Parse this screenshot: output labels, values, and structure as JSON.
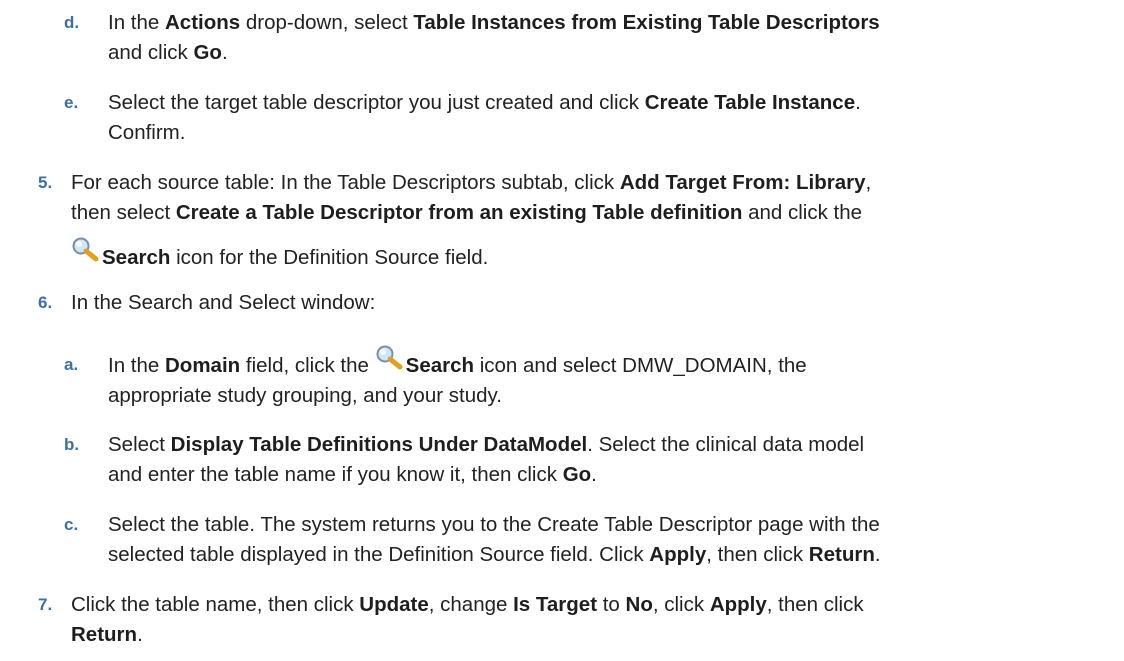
{
  "steps": {
    "d": {
      "marker": "d.",
      "t1": "In the ",
      "b1": "Actions",
      "t2": " drop-down, select ",
      "b2": "Table Instances from Existing Table Descriptors",
      "t3": "and click ",
      "b3": "Go",
      "t4": "."
    },
    "e": {
      "marker": "e.",
      "t1": "Select the target table descriptor you just created and click ",
      "b1": "Create Table Instance",
      "t2": ".",
      "t3": "Confirm."
    },
    "s5": {
      "marker": "5.",
      "t1": "For each source table: In the Table Descriptors subtab, click ",
      "b1": "Add Target From: Library",
      "t2": ",",
      "t3": "then select ",
      "b2": "Create a Table Descriptor from an existing Table definition",
      "t4": " and click the",
      "b3": "Search",
      "t5": " icon for the Definition Source field."
    },
    "s6": {
      "marker": "6.",
      "t1": "In the Search and Select window:"
    },
    "a": {
      "marker": "a.",
      "t1": "In the ",
      "b1": "Domain",
      "t2": " field, click the ",
      "b2": "Search",
      "t3": " icon and select DMW_DOMAIN, the",
      "t4": "appropriate study grouping, and your study."
    },
    "b": {
      "marker": "b.",
      "t1": "Select ",
      "b1": "Display Table Definitions Under DataModel",
      "t2": ". Select the clinical data model",
      "t3": "and enter the table name if you know it, then click ",
      "b2": "Go",
      "t4": "."
    },
    "c": {
      "marker": "c.",
      "t1": "Select the table. The system returns you to the Create Table Descriptor page with the",
      "t2": "selected table displayed in the Definition Source field. Click ",
      "b1": "Apply",
      "t3": ", then click ",
      "b2": "Return",
      "t4": "."
    },
    "s7": {
      "marker": "7.",
      "t1": "Click the table name, then click ",
      "b1": "Update",
      "t2": ", change ",
      "b2": "Is Target",
      "t3": " to ",
      "b3": "No",
      "t4": ", click ",
      "b4": "Apply",
      "t5": ", then click",
      "b5": "Return",
      "t6": "."
    }
  },
  "icons": {
    "search": "magnifying-glass-icon",
    "lens_color": "#b8d8f0",
    "handle_color": "#e0a020"
  },
  "colors": {
    "marker": "#3a6fa8",
    "text": "#222222"
  }
}
